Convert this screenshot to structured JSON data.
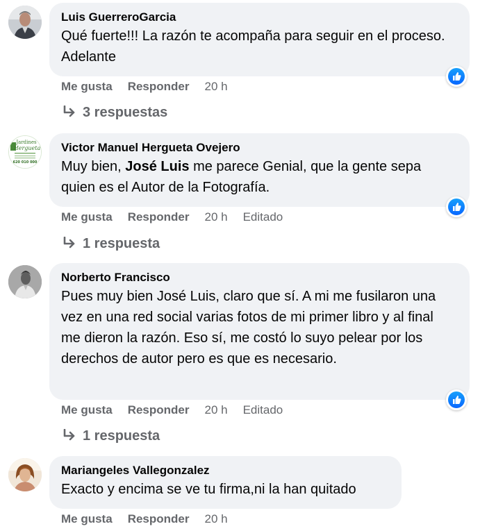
{
  "comments": [
    {
      "author": "Luis GuerreroGarcia",
      "text_plain": "Qué fuerte!!! La razón te acompaña para seguir en el proceso. Adelante",
      "actions": {
        "like": "Me gusta",
        "reply": "Responder",
        "time": "20 h",
        "edited": ""
      },
      "replies": "3 respuestas"
    },
    {
      "author": "Victor Manuel Hergueta Ovejero",
      "text_before": "Muy bien, ",
      "mention": "José Luis",
      "text_after": " me parece Genial, que la gente sepa quien es el Autor de la Fotografía.",
      "actions": {
        "like": "Me gusta",
        "reply": "Responder",
        "time": "20 h",
        "edited": "Editado"
      },
      "replies": "1 respuesta",
      "avatar_text": {
        "line1": "Jardines",
        "line2": "Hergueta",
        "phone": "620 010 000"
      }
    },
    {
      "author": "Norberto Francisco",
      "text_plain": "Pues muy bien José Luis, claro que sí. A mi me fusilaron una vez en una red social varias fotos de mi primer libro y al final me dieron la razón. Eso sí, me costó lo suyo pelear por los derechos de autor pero es que es necesario.",
      "actions": {
        "like": "Me gusta",
        "reply": "Responder",
        "time": "20 h",
        "edited": "Editado"
      },
      "replies": "1 respuesta"
    },
    {
      "author": "Mariangeles Vallegonzalez",
      "text_plain": "Exacto y encima se ve tu firma,ni la han quitado",
      "actions": {
        "like": "Me gusta",
        "reply": "Responder",
        "time": "20 h",
        "edited": ""
      }
    }
  ],
  "icons": {
    "like_badge": "thumbs-up-icon",
    "reply_arrow": "reply-arrow-icon"
  },
  "colors": {
    "bubble": "#f0f2f5",
    "secondary_text": "#65676b",
    "like_blue": "#0866ff"
  }
}
